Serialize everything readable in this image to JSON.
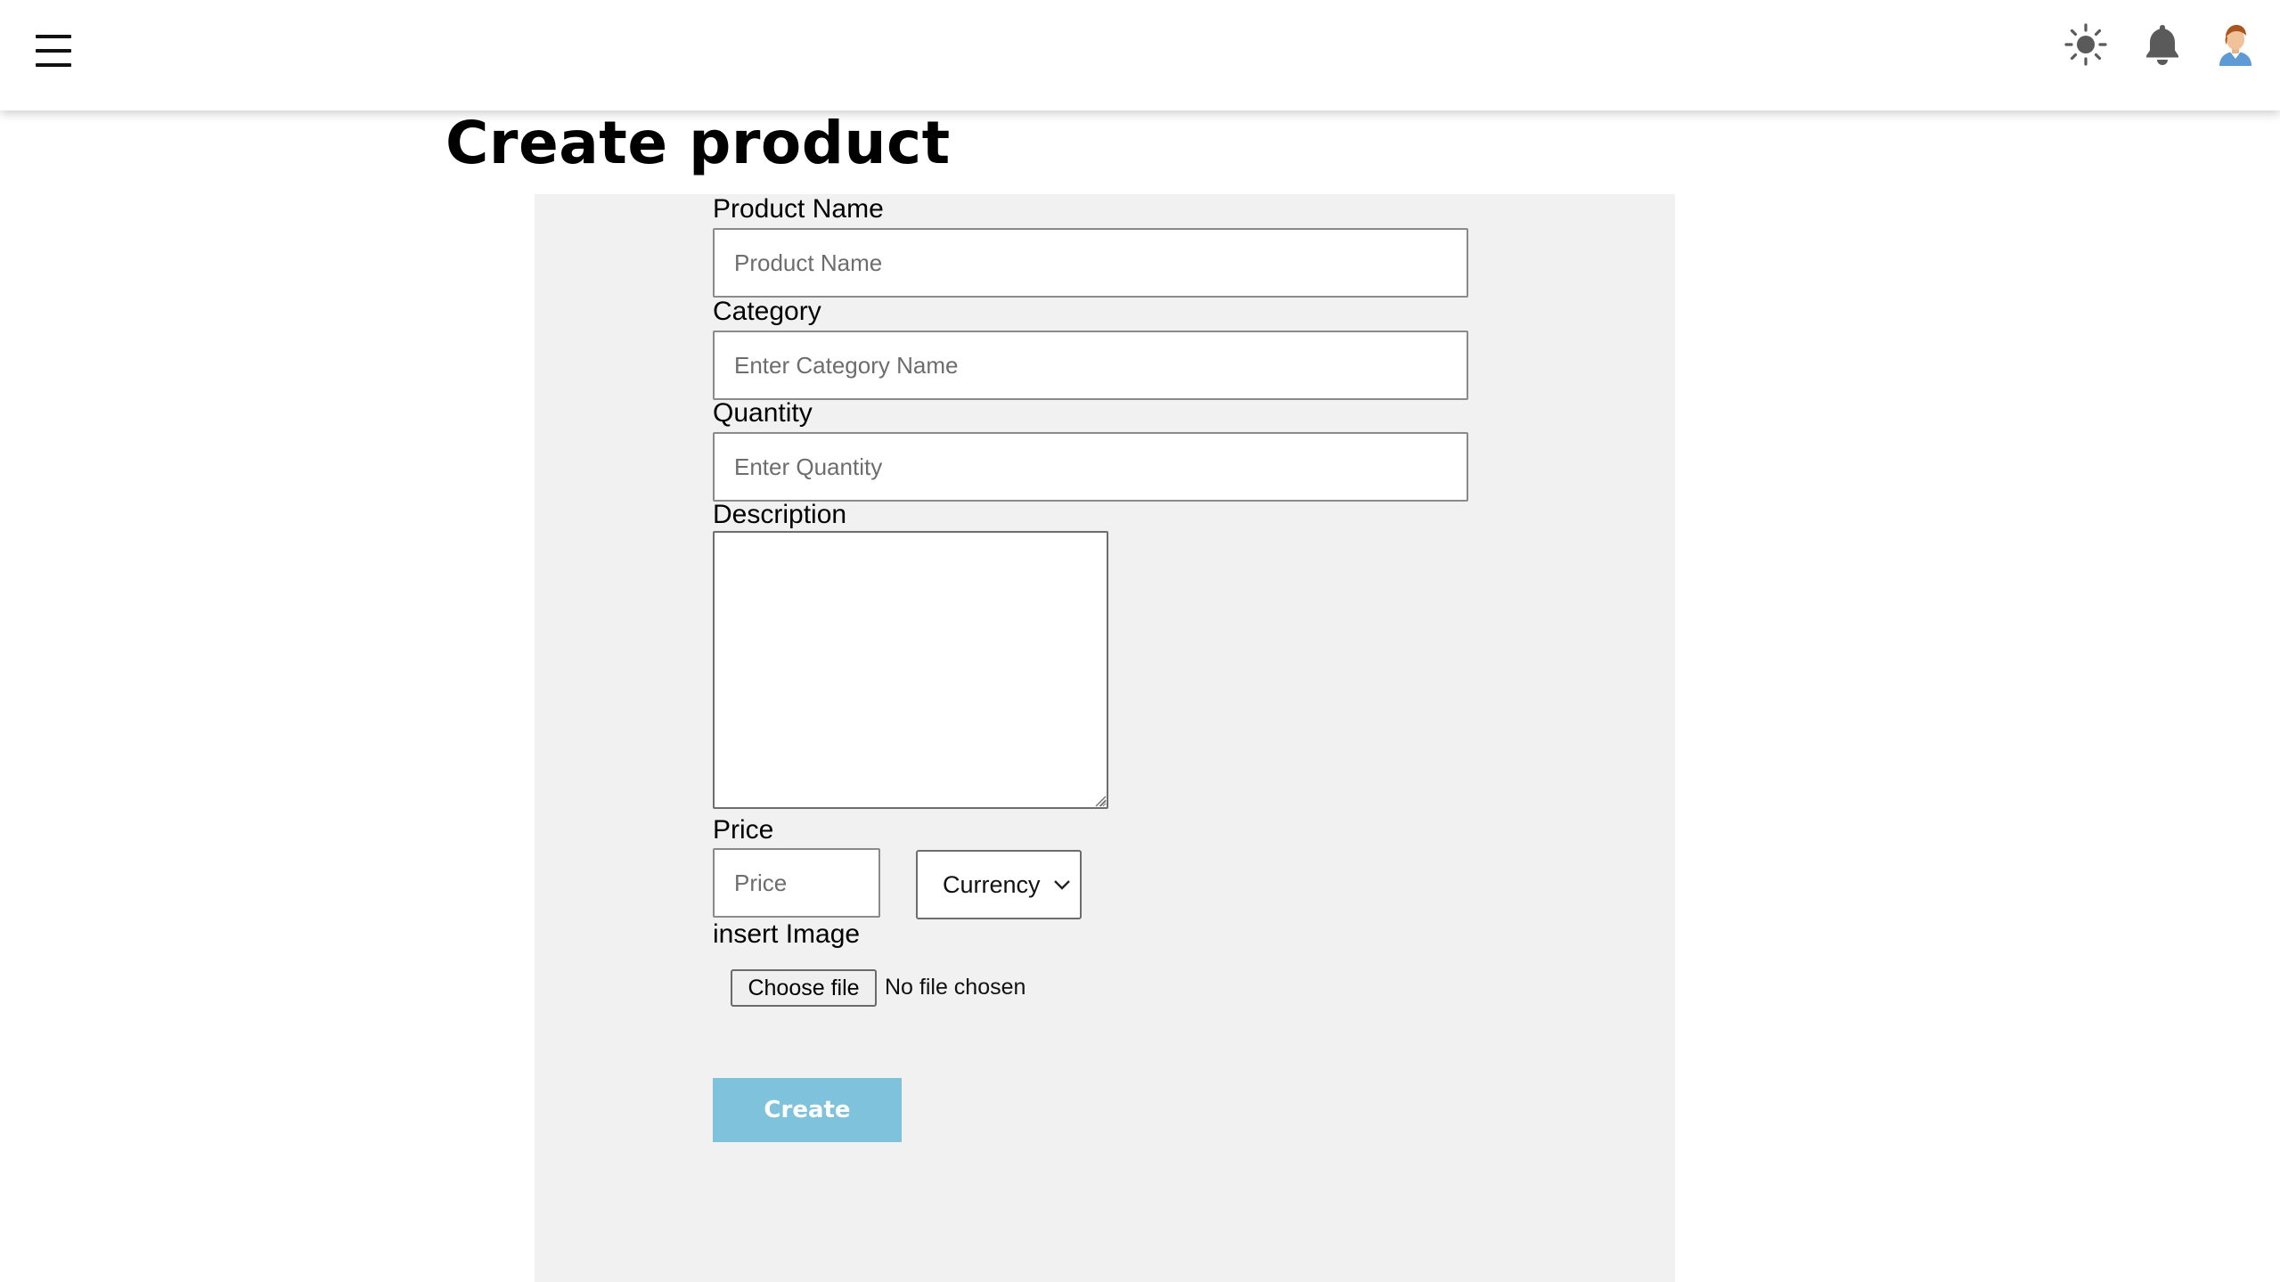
{
  "header": {
    "menu_icon": "hamburger-menu-icon",
    "theme_icon": "sun-icon",
    "notification_icon": "bell-icon",
    "profile_icon": "avatar-icon"
  },
  "page": {
    "title": "Create product"
  },
  "form": {
    "product_name": {
      "label": "Product Name",
      "placeholder": "Product Name",
      "value": ""
    },
    "category": {
      "label": "Category",
      "placeholder": "Enter Category Name",
      "value": ""
    },
    "quantity": {
      "label": "Quantity",
      "placeholder": "Enter Quantity",
      "value": ""
    },
    "description": {
      "label": "Description",
      "value": ""
    },
    "price": {
      "label": "Price",
      "placeholder": "Price",
      "value": ""
    },
    "currency": {
      "selected": "Currency"
    },
    "image": {
      "label": "insert Image",
      "button_label": "Choose file",
      "status": "No file chosen"
    },
    "submit_label": "Create"
  },
  "colors": {
    "panel_bg": "#f1f1f1",
    "create_button_bg": "#7fc2dc",
    "header_bg": "#ffffff"
  }
}
